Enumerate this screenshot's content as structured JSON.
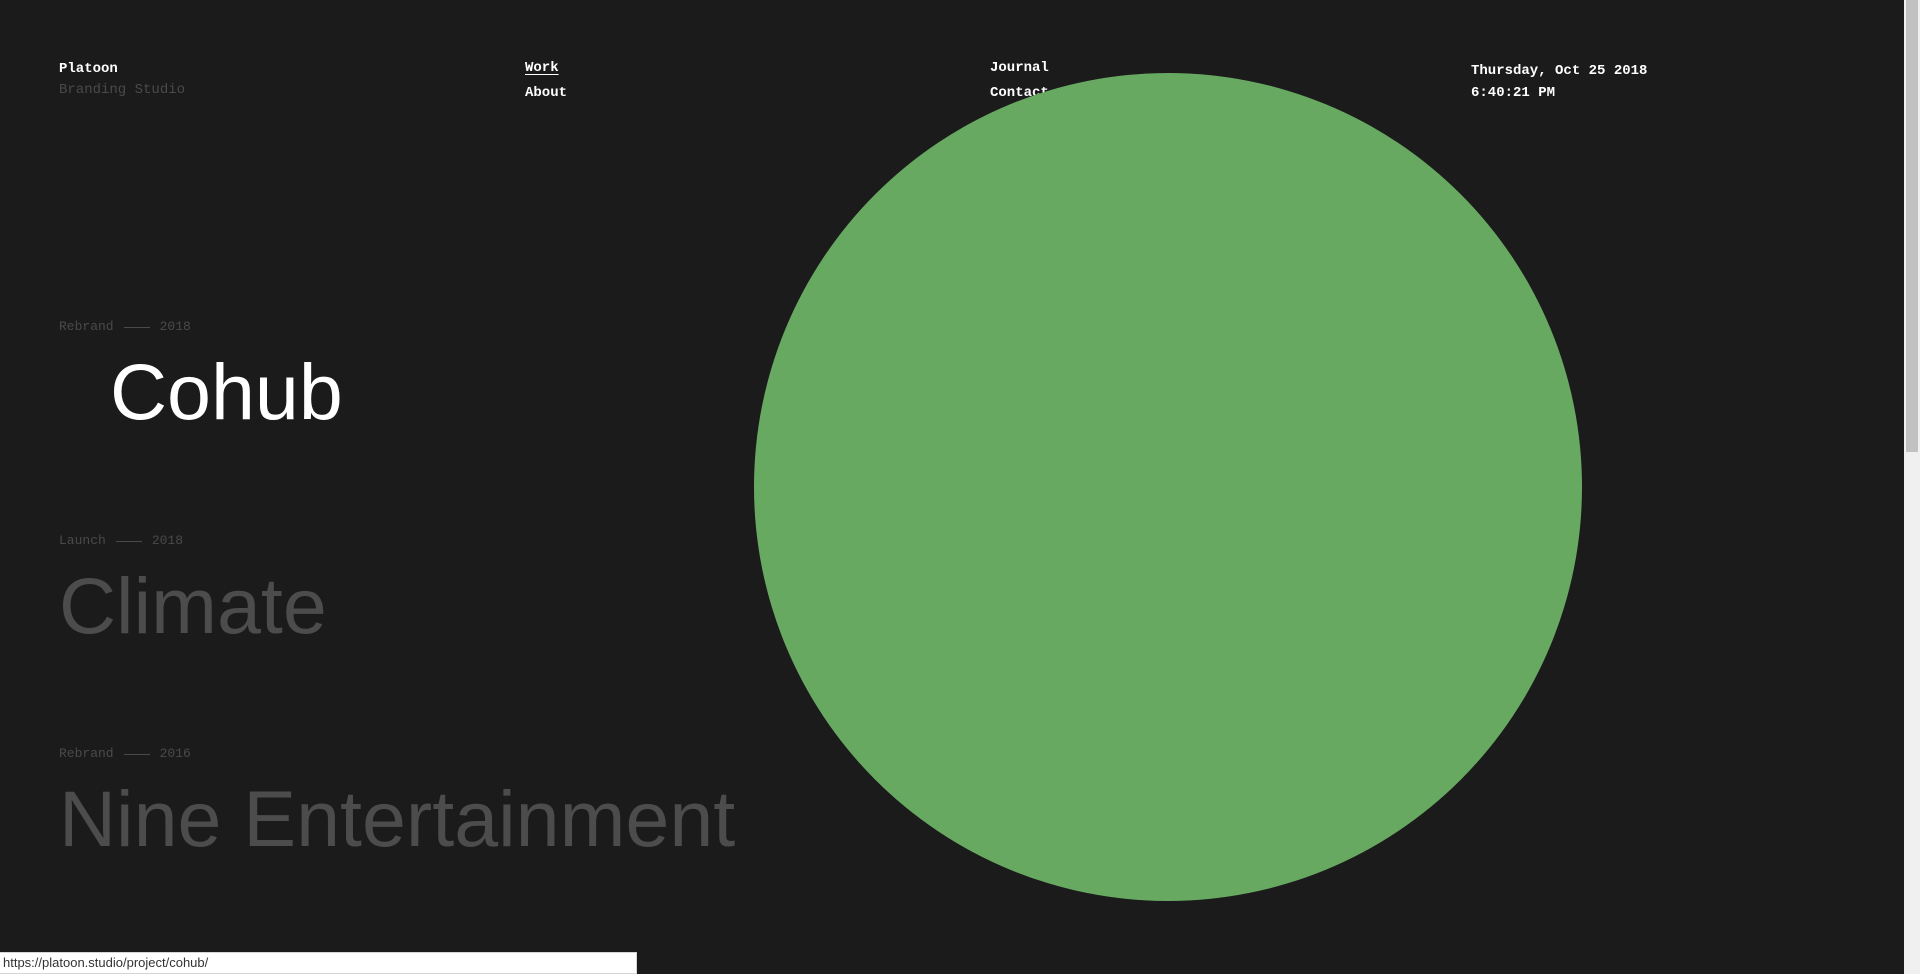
{
  "brand": {
    "name": "Platoon",
    "tagline": "Branding Studio"
  },
  "nav": {
    "col1": [
      "Work",
      "About"
    ],
    "col2": [
      "Journal",
      "Contact"
    ],
    "active": "Work"
  },
  "clock": {
    "date": "Thursday, Oct 25 2018",
    "time": "6:40:21 PM"
  },
  "projects": [
    {
      "category": "Rebrand",
      "year": "2018",
      "title": "Cohub",
      "active": true
    },
    {
      "category": "Launch",
      "year": "2018",
      "title": "Climate",
      "active": false
    },
    {
      "category": "Rebrand",
      "year": "2016",
      "title": "Nine Entertainment",
      "active": false
    }
  ],
  "colors": {
    "background": "#1b1b1b",
    "circle": "#68a962",
    "muted_text": "#4a4a4a",
    "inactive_title": "#4c4c4c"
  },
  "status_bar": {
    "url": "https://platoon.studio/project/cohub/"
  }
}
